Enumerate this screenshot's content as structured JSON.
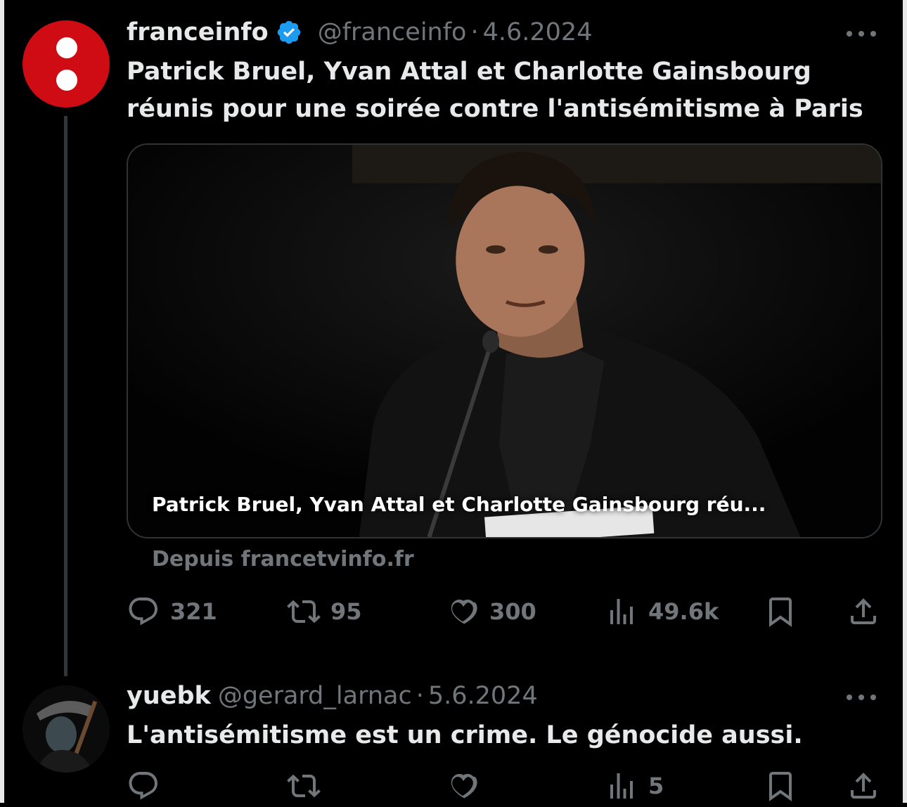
{
  "tweet": {
    "author_name": "franceinfo",
    "handle": "@franceinfo",
    "separator": "·",
    "date": "4.6.2024",
    "text_line1": "Patrick Bruel, Yvan Attal et Charlotte Gainsbourg",
    "text_line2": "réunis pour une soirée contre l'antisémitisme à Paris",
    "card": {
      "caption": "Patrick Bruel, Yvan Attal et Charlotte Gainsbourg réu...",
      "source": "Depuis francetvinfo.fr"
    },
    "stats": {
      "replies": "321",
      "reposts": "95",
      "likes": "300",
      "views": "49.6k"
    }
  },
  "reply": {
    "author_name": "yuebk",
    "handle": "@gerard_larnac",
    "separator": "·",
    "date": "5.6.2024",
    "text": "L'antisémitisme est un crime. Le génocide aussi.",
    "stats": {
      "views": "5"
    }
  },
  "colors": {
    "background": "#000000",
    "text_primary": "#e7e9ea",
    "text_secondary": "#71767b",
    "verified_blue": "#1d9bf0",
    "franceinfo_red": "#cf0b14"
  },
  "icons": [
    "more-icon",
    "verified-badge-icon",
    "reply-icon",
    "repost-icon",
    "like-icon",
    "views-icon",
    "bookmark-icon",
    "share-icon"
  ]
}
